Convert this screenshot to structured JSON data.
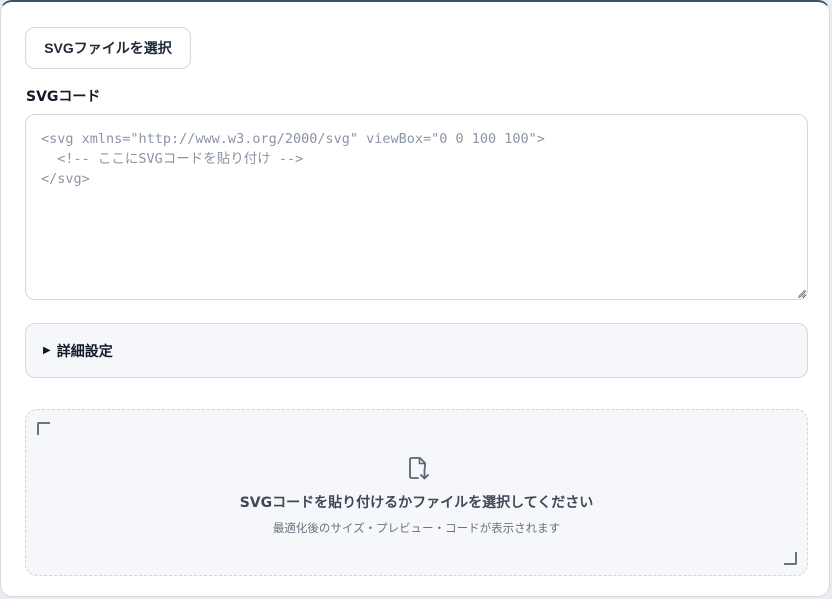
{
  "toolbar": {
    "select_file_label": "SVGファイルを選択"
  },
  "editor": {
    "label": "SVGコード",
    "placeholder": "<svg xmlns=\"http://www.w3.org/2000/svg\" viewBox=\"0 0 100 100\">\n  <!-- ここにSVGコードを貼り付け -->\n</svg>",
    "value": ""
  },
  "advanced": {
    "arrow": "▶",
    "label": "詳細設定"
  },
  "dropzone": {
    "icon": "file-download-icon",
    "title": "SVGコードを貼り付けるかファイルを選択してください",
    "subtitle": "最適化後のサイズ・プレビュー・コードが表示されます"
  },
  "colors": {
    "accent_border": "#3c5068",
    "panel_bg": "#f6f7fa",
    "border": "#d3d9e1",
    "placeholder_text": "#8b95a3"
  }
}
